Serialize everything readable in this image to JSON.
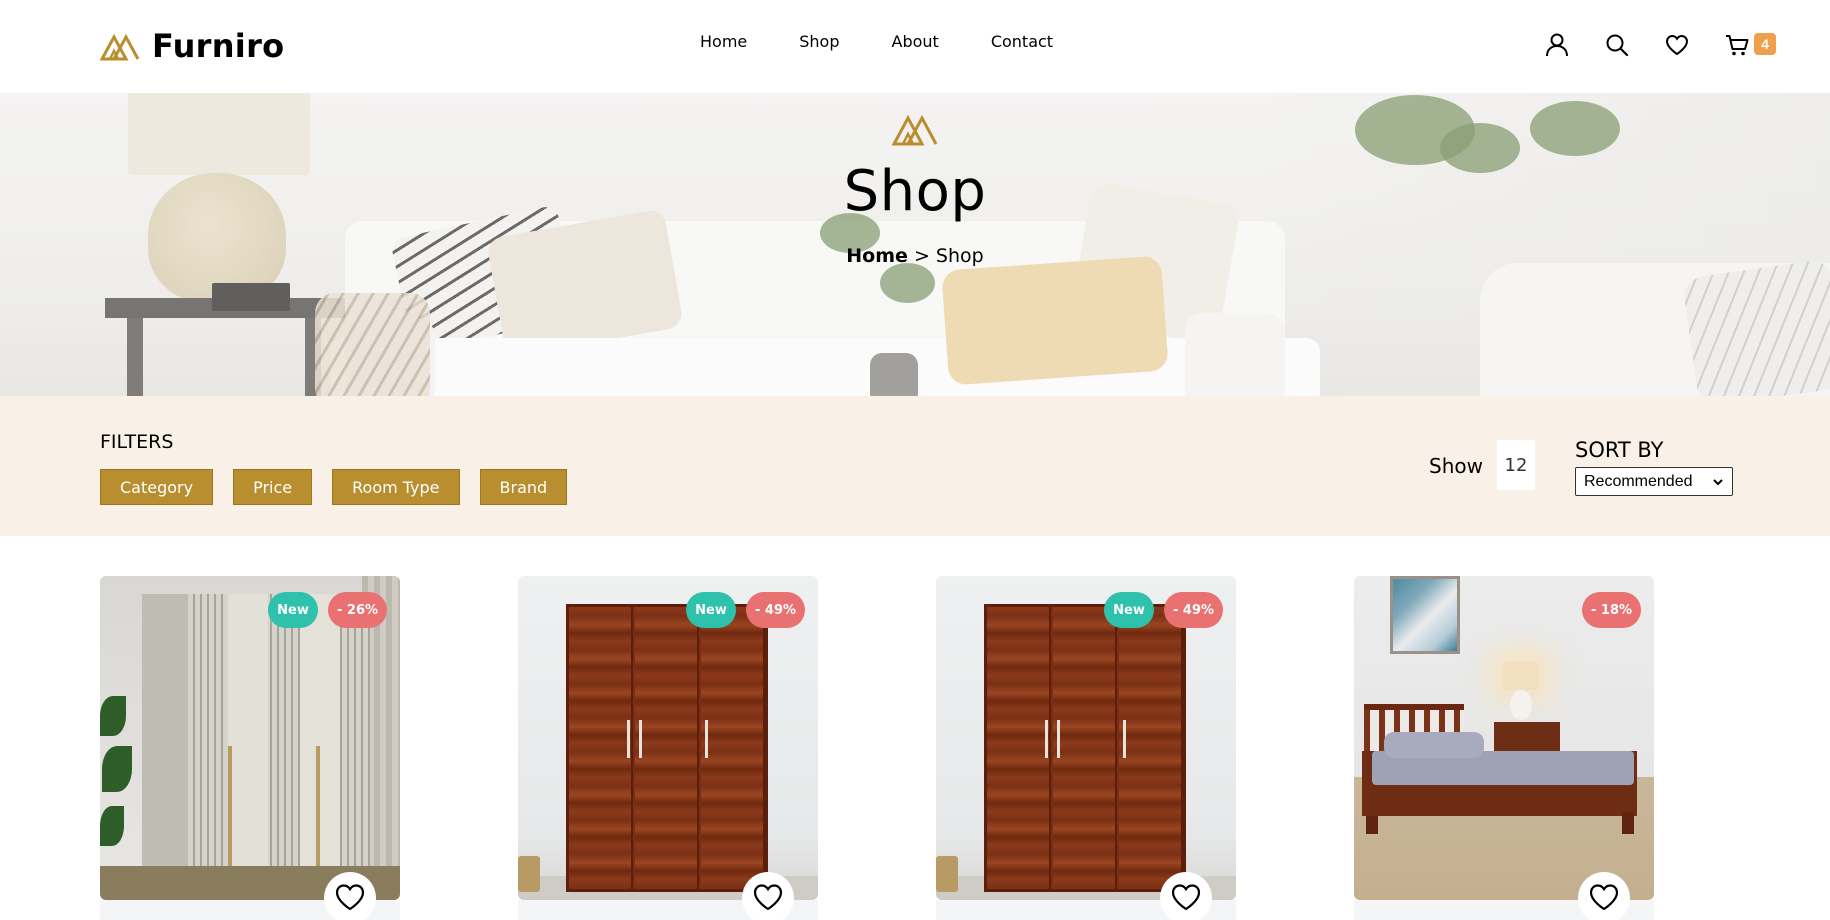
{
  "brand": {
    "name": "Furniro",
    "accent": "#b88e2f"
  },
  "nav": {
    "items": [
      "Home",
      "Shop",
      "About",
      "Contact"
    ]
  },
  "header_icons": [
    "user-icon",
    "search-icon",
    "heart-icon",
    "cart-icon"
  ],
  "cart": {
    "count": "4",
    "badge_color": "#f0a04b"
  },
  "hero": {
    "title": "Shop",
    "breadcrumb_home": "Home",
    "breadcrumb_sep": " > ",
    "breadcrumb_current": "Shop"
  },
  "filters": {
    "title": "FILTERS",
    "chips": [
      "Category",
      "Price",
      "Room Type",
      "Brand"
    ],
    "show_label": "Show",
    "show_value": "12",
    "sort_label": "SORT BY",
    "sort_value": "Recommended"
  },
  "products": [
    {
      "image": "light-fluted-wardrobe",
      "new_badge": "New",
      "discount": "- 26%"
    },
    {
      "image": "wooden-wardrobe",
      "new_badge": "New",
      "discount": "- 49%"
    },
    {
      "image": "wooden-wardrobe",
      "new_badge": "New",
      "discount": "- 49%"
    },
    {
      "image": "wooden-single-bed",
      "new_badge": "",
      "discount": "- 18%"
    }
  ],
  "colors": {
    "new_badge": "#2ec1ac",
    "discount_badge": "#e97171",
    "filter_bar": "#f9f1e7"
  }
}
